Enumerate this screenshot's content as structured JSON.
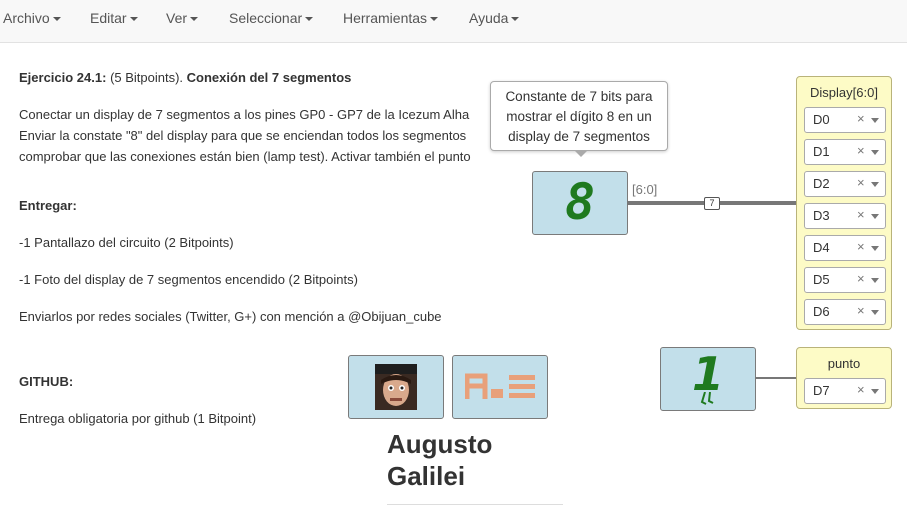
{
  "menu": {
    "items": [
      "Archivo",
      "Editar",
      "Ver",
      "Seleccionar",
      "Herramientas",
      "Ayuda"
    ]
  },
  "exercise": {
    "title_prefix": "Ejercicio 24.1:",
    "title_points": " (5 Bitpoints). ",
    "title_main": "Conexión del 7 segmentos",
    "line1": "Conectar un display de 7 segmentos a los pines GP0 - GP7 de la Icezum Alha",
    "line2": "Enviar la constate \"8\" del display para que se enciendan todos los segmentos",
    "line3": "comprobar que las conexiones están bien (lamp test). Activar también el punto",
    "deliver_heading": "Entregar:",
    "deliver1": "-1 Pantallazo del circuito (2 Bitpoints)",
    "deliver2": "-1 Foto del display de 7 segmentos encendido (2 Bitpoints)",
    "social": "Enviarlos por redes sociales (Twitter, G+) con mención a @Obijuan_cube",
    "github_heading": "GITHUB:",
    "github_text": "Entrega obligatoria por github (1 Bitpoint)"
  },
  "circuit": {
    "const_block_value": "8",
    "tooltip_line1": "Constante de 7 bits para",
    "tooltip_line2": "mostrar el dígito 8 en un",
    "tooltip_line3": "display de 7 segmentos",
    "bus_label": "[6:0]",
    "bus_size": "7",
    "display_panel": {
      "title": "Display[6:0]",
      "pins": [
        "D0",
        "D1",
        "D2",
        "D3",
        "D4",
        "D5",
        "D6"
      ]
    },
    "bit_block_value": "1",
    "punto_panel": {
      "title": "punto",
      "pins": [
        "D7"
      ]
    },
    "clear_glyph": "×",
    "author_line1": "Augusto",
    "author_line2": "Galilei",
    "accent_green": "#1f7a1f",
    "block_color": "#c2dfea",
    "panel_color": "#fdfbc6"
  }
}
